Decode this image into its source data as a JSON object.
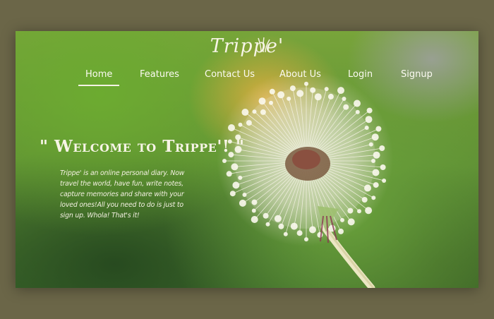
{
  "brand": {
    "logo_text": "Trippe'"
  },
  "nav": {
    "items": [
      {
        "label": "Home",
        "active": true
      },
      {
        "label": "Features"
      },
      {
        "label": "Contact Us"
      },
      {
        "label": "About Us"
      },
      {
        "label": "Login"
      },
      {
        "label": "Signup"
      }
    ]
  },
  "hero": {
    "title": "\" Welcome to Trippe'! \"",
    "description": "Trippe' is an online personal diary. Now travel the world, have fun, write notes, capture memories and share with your loved ones!All you need to do is just to sign up. Whola! That's it!"
  },
  "colors": {
    "page_bg": "#6b6648",
    "text": "#f7f4e6",
    "accent_green": "#6cac30"
  }
}
